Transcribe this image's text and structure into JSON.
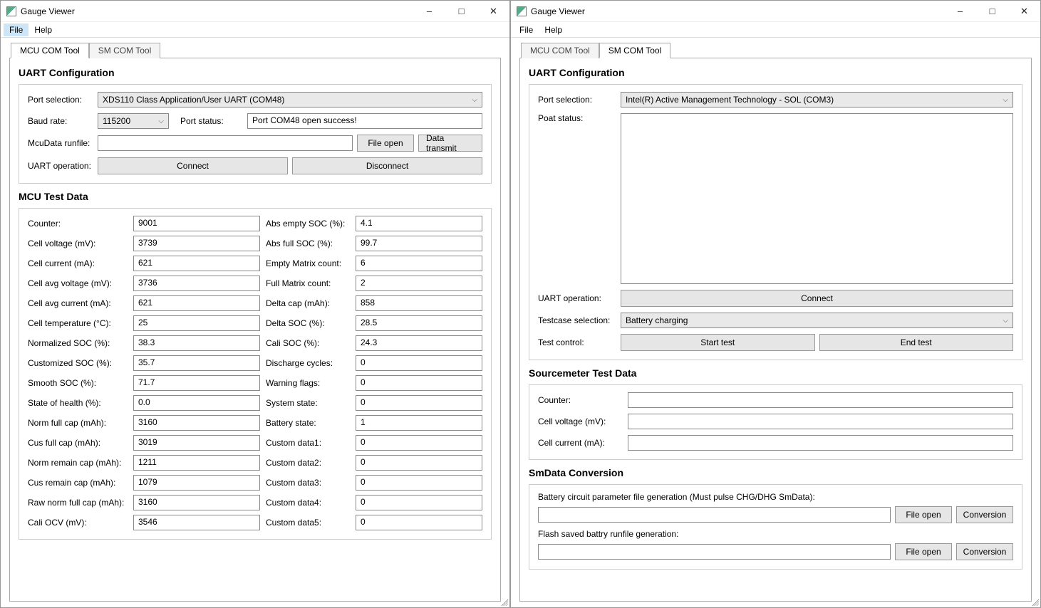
{
  "appTitle": "Gauge Viewer",
  "menu": {
    "file": "File",
    "help": "Help"
  },
  "tabs": {
    "mcu": "MCU COM Tool",
    "sm": "SM COM Tool"
  },
  "left": {
    "uart": {
      "header": "UART Configuration",
      "portLabel": "Port selection:",
      "portValue": "XDS110 Class Application/User UART (COM48)",
      "baudLabel": "Baud rate:",
      "baudValue": "115200",
      "portStatusLabel": "Port status:",
      "portStatusValue": "Port COM48 open success!",
      "runfileLabel": "McuData runfile:",
      "runfileValue": "",
      "fileOpenBtn": "File open",
      "dataTransmitBtn": "Data transmit",
      "uartOpLabel": "UART operation:",
      "connectBtn": "Connect",
      "disconnectBtn": "Disconnect"
    },
    "testHeader": "MCU Test Data",
    "rows": [
      {
        "l1": "Counter:",
        "v1": "9001",
        "l2": "Abs empty SOC (%):",
        "v2": "4.1"
      },
      {
        "l1": "Cell voltage (mV):",
        "v1": "3739",
        "l2": "Abs full SOC (%):",
        "v2": "99.7"
      },
      {
        "l1": "Cell current (mA):",
        "v1": "621",
        "l2": "Empty Matrix count:",
        "v2": "6"
      },
      {
        "l1": "Cell avg voltage (mV):",
        "v1": "3736",
        "l2": "Full Matrix count:",
        "v2": "2"
      },
      {
        "l1": "Cell avg current (mA):",
        "v1": "621",
        "l2": "Delta cap (mAh):",
        "v2": "858"
      },
      {
        "l1": "Cell temperature (°C):",
        "v1": "25",
        "l2": "Delta SOC (%):",
        "v2": "28.5"
      },
      {
        "l1": "Normalized SOC (%):",
        "v1": "38.3",
        "l2": "Cali SOC (%):",
        "v2": "24.3"
      },
      {
        "l1": "Customized SOC (%):",
        "v1": "35.7",
        "l2": "Discharge cycles:",
        "v2": "0"
      },
      {
        "l1": "Smooth SOC (%):",
        "v1": "71.7",
        "l2": "Warning flags:",
        "v2": "0"
      },
      {
        "l1": "State of health (%):",
        "v1": "0.0",
        "l2": "System state:",
        "v2": "0"
      },
      {
        "l1": "Norm full cap (mAh):",
        "v1": "3160",
        "l2": "Battery state:",
        "v2": "1"
      },
      {
        "l1": "Cus full cap (mAh):",
        "v1": "3019",
        "l2": "Custom data1:",
        "v2": "0"
      },
      {
        "l1": "Norm remain cap (mAh):",
        "v1": "1211",
        "l2": "Custom data2:",
        "v2": "0"
      },
      {
        "l1": "Cus remain cap (mAh):",
        "v1": "1079",
        "l2": "Custom data3:",
        "v2": "0"
      },
      {
        "l1": "Raw norm full cap (mAh):",
        "v1": "3160",
        "l2": "Custom data4:",
        "v2": "0"
      },
      {
        "l1": "Cali OCV (mV):",
        "v1": "3546",
        "l2": "Custom data5:",
        "v2": "0"
      }
    ]
  },
  "right": {
    "uart": {
      "header": "UART Configuration",
      "portLabel": "Port selection:",
      "portValue": "Intel(R) Active Management Technology - SOL (COM3)",
      "poatLabel": "Poat status:",
      "logValue": "",
      "uartOpLabel": "UART operation:",
      "connectBtn": "Connect",
      "testcaseLabel": "Testcase selection:",
      "testcaseValue": "Battery charging",
      "testCtrlLabel": "Test control:",
      "startBtn": "Start test",
      "endBtn": "End test"
    },
    "smTestHeader": "Sourcemeter Test Data",
    "sm": {
      "counterLabel": "Counter:",
      "counterValue": "",
      "voltLabel": "Cell voltage (mV):",
      "voltValue": "",
      "currLabel": "Cell current (mA):",
      "currValue": ""
    },
    "conv": {
      "header": "SmData Conversion",
      "line1": "Battery circuit parameter file generation (Must pulse CHG/DHG SmData):",
      "path1": "",
      "fileOpenBtn": "File open",
      "convBtn": "Conversion",
      "line2": "Flash saved battry runfile generation:",
      "path2": ""
    }
  }
}
